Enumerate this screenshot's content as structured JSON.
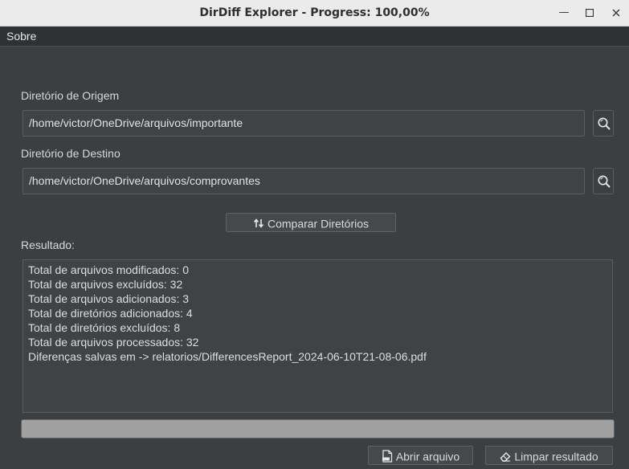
{
  "window": {
    "title": "DirDiff Explorer - Progress: 100,00%"
  },
  "menu": {
    "items": [
      {
        "label": "Sobre"
      }
    ]
  },
  "source": {
    "label": "Diretório de Origem",
    "value": "/home/victor/OneDrive/arquivos/importante",
    "browse_icon": "search-icon"
  },
  "destination": {
    "label": "Diretório de Destino",
    "value": "/home/victor/OneDrive/arquivos/comprovantes",
    "browse_icon": "search-icon"
  },
  "compare_button": {
    "label": "Comparar Diretórios",
    "icon": "swap-icon"
  },
  "result": {
    "label": "Resultado:",
    "lines": [
      "Total de arquivos modificados: 0",
      "Total de arquivos excluídos: 32",
      "Total de arquivos adicionados: 3",
      "Total de diretórios adicionados: 4",
      "Total de diretórios excluídos: 8",
      "Total de arquivos processados: 32",
      "Diferenças salvas em -> relatorios/DifferencesReport_2024-06-10T21-08-06.pdf"
    ]
  },
  "progress": {
    "fraction": 1.0
  },
  "footer": {
    "open_button": {
      "label": "Abrir arquivo",
      "icon": "pdf-file-icon"
    },
    "clear_button": {
      "label": "Limpar resultado",
      "icon": "eraser-icon"
    }
  }
}
